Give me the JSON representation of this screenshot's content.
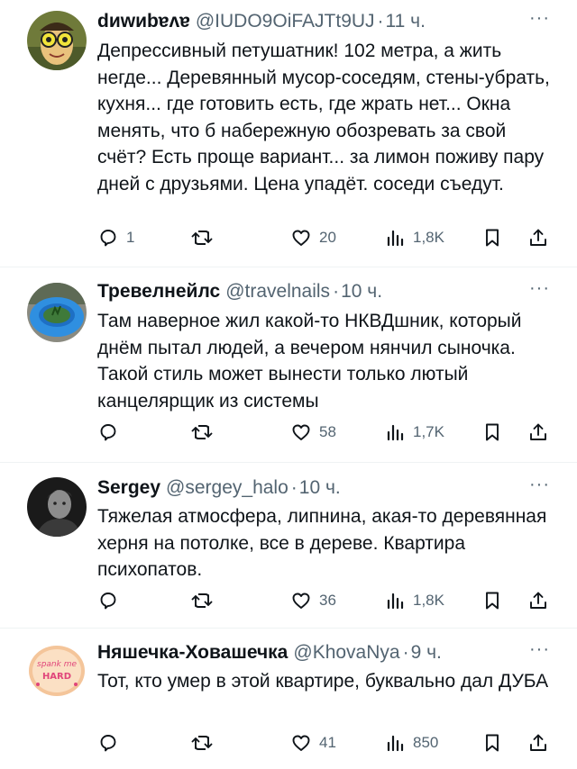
{
  "colors": {
    "text": "#0f1419",
    "secondary": "#536471",
    "divider": "#eff3f4"
  },
  "tweets": [
    {
      "name": "dиwиbɐʌɐ",
      "handle": "@IUDO9OiFAJTt9UJ",
      "time": "11 ч.",
      "more": "···",
      "text": "Депрессивный петушатник! 102 метра, а жить негде... Деревянный мусор-соседям, стены-убрать, кухня... где готовить есть, где жрать нет... Окна менять, что б набережную обозревать за свой счёт? Есть проще вариант... за лимон поживу пару дней с друзьями.  Цена упадёт. соседи съедут.",
      "replies": "1",
      "retweets": "",
      "likes": "20",
      "views": "1,8K",
      "icons": [
        "reply-icon",
        "retweet-icon",
        "like-icon",
        "views-icon",
        "bookmark-icon",
        "share-icon"
      ]
    },
    {
      "name": "Тревелнейлс",
      "handle": "@travelnails",
      "time": "10 ч.",
      "more": "···",
      "text": "Там наверное жил какой-то НКВДшник, который днём пытал людей, а вечером нянчил сыночка. Такой стиль может вынести только лютый канцелярщик из системы",
      "replies": "",
      "retweets": "",
      "likes": "58",
      "views": "1,7K",
      "icons": [
        "reply-icon",
        "retweet-icon",
        "like-icon",
        "views-icon",
        "bookmark-icon",
        "share-icon"
      ]
    },
    {
      "name": "Sergey",
      "handle": "@sergey_halo",
      "time": "10 ч.",
      "more": "···",
      "text": "Тяжелая атмосфера, липнина, акая-то деревянная херня на потолке, все в дереве. Квартира психопатов.",
      "replies": "",
      "retweets": "",
      "likes": "36",
      "views": "1,8K",
      "icons": [
        "reply-icon",
        "retweet-icon",
        "like-icon",
        "views-icon",
        "bookmark-icon",
        "share-icon"
      ]
    },
    {
      "name": "Няшечка-Ховашечка",
      "handle": "@KhovaNya",
      "time": "9 ч.",
      "more": "···",
      "text": "Тот, кто умер в этой квартире, буквально дал ДУБА",
      "replies": "",
      "retweets": "",
      "likes": "41",
      "views": "850",
      "avatar_text": [
        "spank me",
        "HARD"
      ],
      "icons": [
        "reply-icon",
        "retweet-icon",
        "like-icon",
        "views-icon",
        "bookmark-icon",
        "share-icon"
      ]
    }
  ]
}
